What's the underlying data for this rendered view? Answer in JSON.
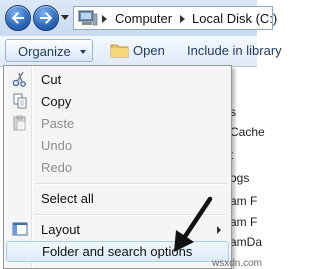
{
  "address_bar": {
    "breadcrumb": [
      "Computer",
      "Local Disk (C:)"
    ]
  },
  "toolbar": {
    "organize_label": "Organize",
    "open_label": "Open",
    "include_label": "Include in library"
  },
  "background_list": {
    "items": [
      "s",
      "Cache",
      "t",
      "ogs",
      "am F",
      "am F",
      "amDa"
    ]
  },
  "menu": {
    "items": [
      {
        "label": "Cut",
        "icon": "scissors-icon",
        "enabled": true
      },
      {
        "label": "Copy",
        "icon": "copy-icon",
        "enabled": true
      },
      {
        "label": "Paste",
        "icon": "paste-icon",
        "enabled": false
      },
      {
        "label": "Undo",
        "enabled": false
      },
      {
        "label": "Redo",
        "enabled": false
      },
      {
        "label": "Select all",
        "enabled": true
      },
      {
        "label": "Layout",
        "icon": "layout-icon",
        "enabled": true,
        "has_submenu": true
      },
      {
        "label": "Folder and search options",
        "enabled": true,
        "highlighted": true
      }
    ]
  },
  "watermark": "wsxdn.com",
  "colors": {
    "accent": "#2c67b9",
    "highlight_border": "#a8cdf5",
    "disabled_text": "#8d8d8d"
  }
}
